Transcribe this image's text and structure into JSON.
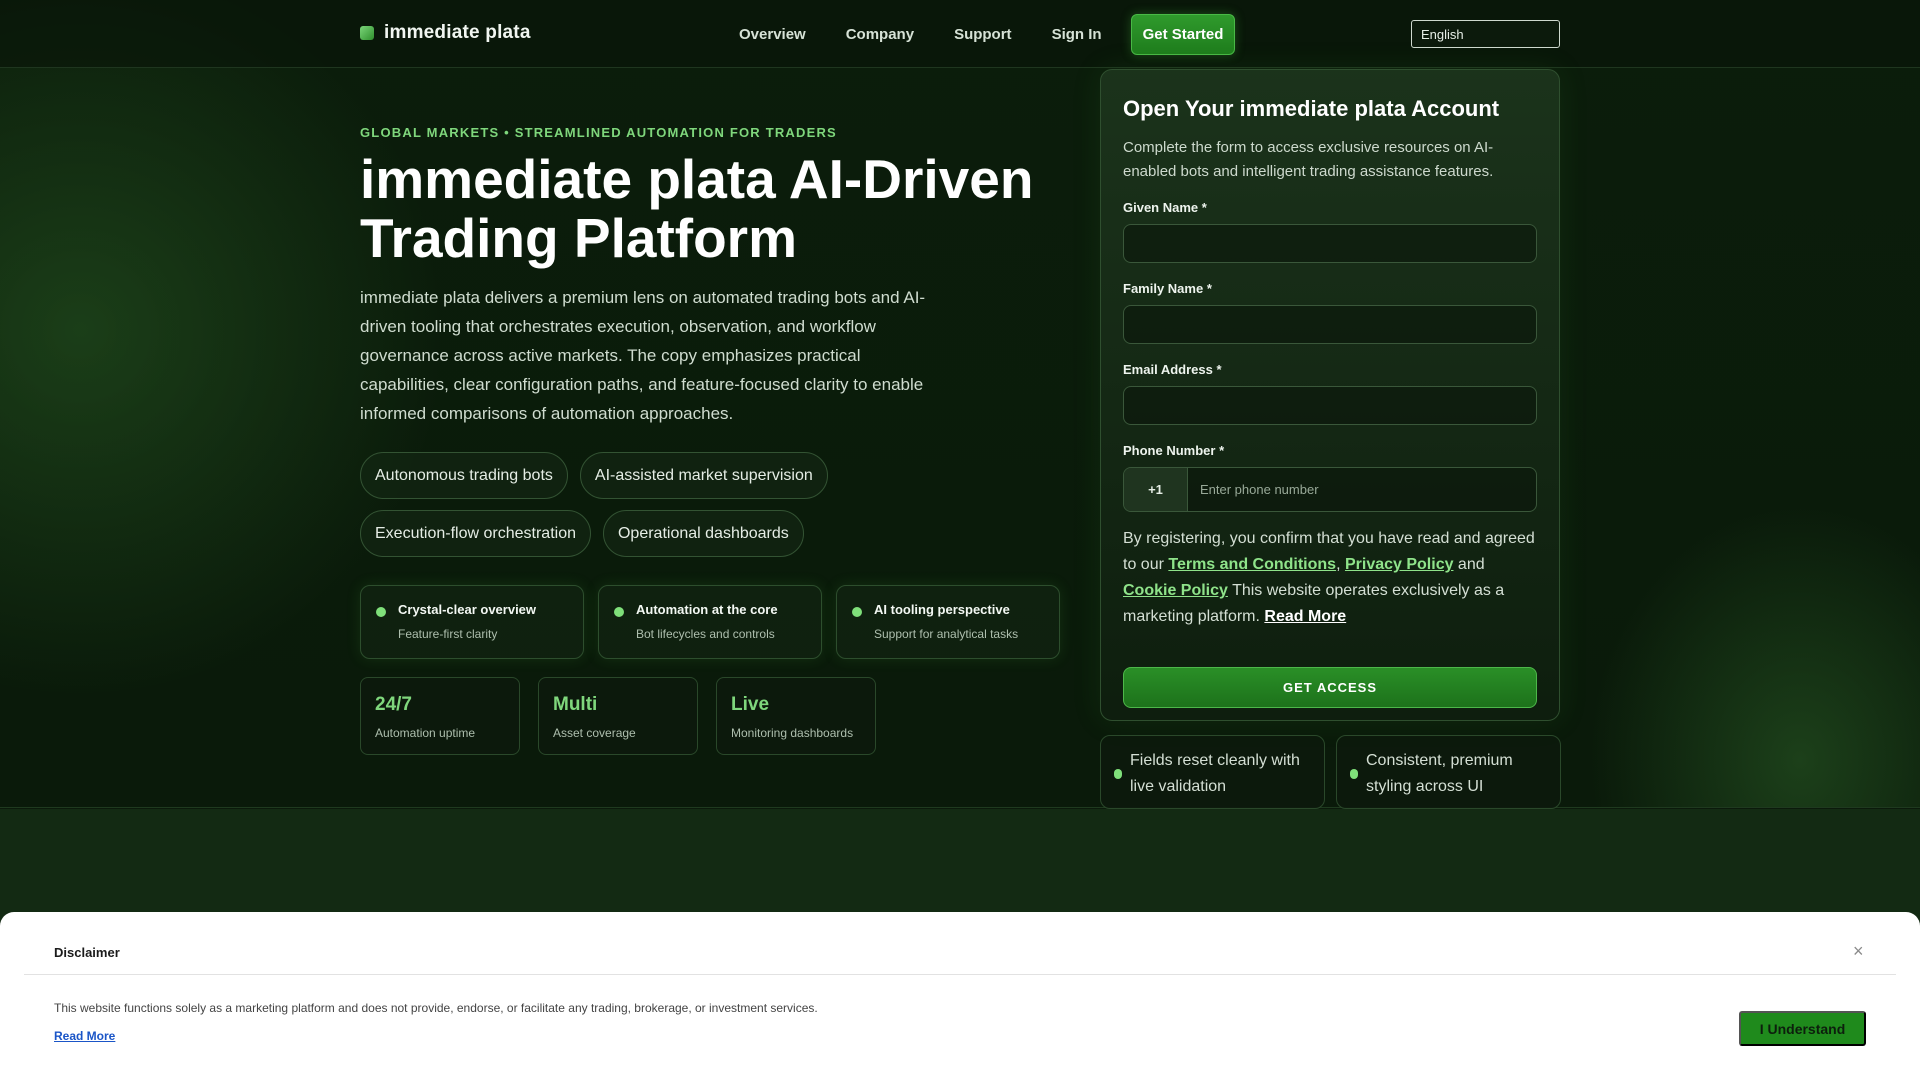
{
  "nav": {
    "brand": "immediate plata",
    "links": [
      "Overview",
      "Company",
      "Support",
      "Sign In"
    ],
    "cta": "Get Started",
    "language": "English"
  },
  "hero": {
    "eyebrow": "GLOBAL MARKETS • STREAMLINED AUTOMATION FOR TRADERS",
    "headline": "immediate plata AI-Driven Trading Platform",
    "lead": "immediate plata delivers a premium lens on automated trading bots and AI-driven tooling that orchestrates execution, observation, and workflow governance across active markets. The copy emphasizes practical capabilities, clear configuration paths, and feature-focused clarity to enable informed comparisons of automation approaches.",
    "pills": [
      "Autonomous trading bots",
      "AI-assisted market supervision",
      "Execution-flow orchestration",
      "Operational dashboards"
    ],
    "features": [
      {
        "title": "Crystal-clear overview",
        "sub": "Feature-first clarity"
      },
      {
        "title": "Automation at the core",
        "sub": "Bot lifecycles and controls"
      },
      {
        "title": "AI tooling perspective",
        "sub": "Support for analytical tasks"
      }
    ],
    "stats": [
      {
        "value": "24/7",
        "label": "Automation uptime"
      },
      {
        "value": "Multi",
        "label": "Asset coverage"
      },
      {
        "value": "Live",
        "label": "Monitoring dashboards"
      }
    ]
  },
  "form": {
    "title": "Open Your immediate plata Account",
    "desc": "Complete the form to access exclusive resources on AI-enabled bots and intelligent trading assistance features.",
    "given_label": "Given Name *",
    "family_label": "Family Name *",
    "email_label": "Email Address *",
    "phone_label": "Phone Number *",
    "phone_code": "+1",
    "phone_placeholder": "Enter phone number",
    "consent_pre": "By registering, you confirm that you have read and agreed to our ",
    "terms": "Terms and Conditions",
    "comma": ", ",
    "privacy": "Privacy Policy",
    "and": " and ",
    "cookie": "Cookie Policy",
    "consent_post": " This website operates exclusively as a marketing platform. ",
    "read_more": "Read More",
    "submit": "GET ACCESS"
  },
  "notes": [
    "Fields reset cleanly with live validation",
    "Consistent, premium styling across UI"
  ],
  "disclaimer": {
    "title": "Disclaimer",
    "close": "×",
    "text": "This website functions solely as a marketing platform and does not provide, endorse, or facilitate any trading, brokerage, or investment services.",
    "link": "Read More",
    "button": "I Understand"
  }
}
